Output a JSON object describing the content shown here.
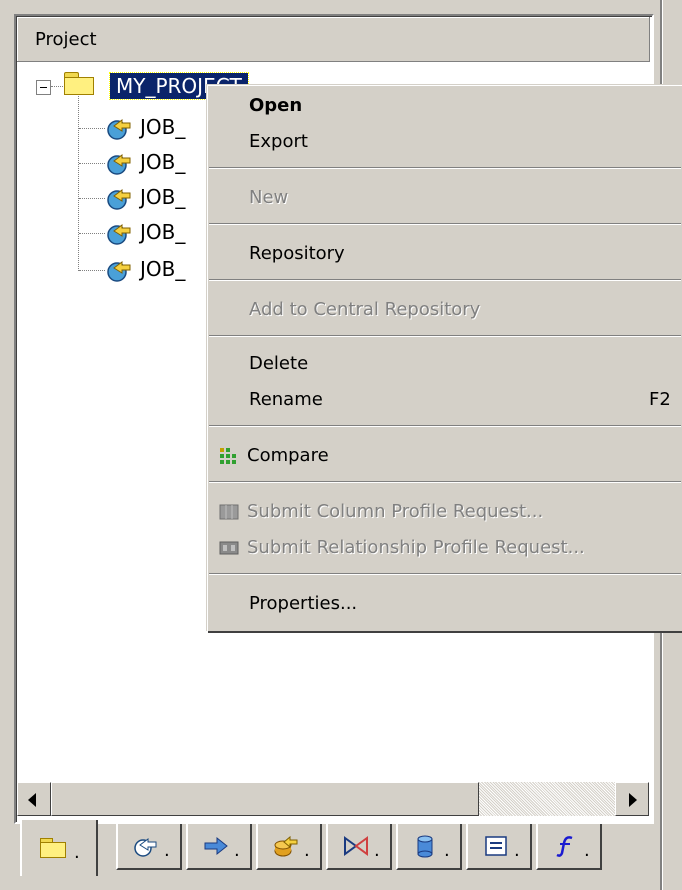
{
  "panel": {
    "header_label": "Project"
  },
  "tree": {
    "project": {
      "label": "MY_PROJECT",
      "visible_label": "MY_PROJECT",
      "selected": true,
      "expanded": true
    },
    "jobs": [
      {
        "label": "JOB_"
      },
      {
        "label": "JOB_"
      },
      {
        "label": "JOB_"
      },
      {
        "label": "JOB_"
      },
      {
        "label": "JOB_"
      }
    ]
  },
  "context_menu": {
    "items": [
      {
        "label": "Open",
        "bold": true,
        "enabled": true
      },
      {
        "label": "Export",
        "enabled": true
      },
      {
        "label": "New",
        "enabled": false
      },
      {
        "label": "Repository",
        "enabled": true
      },
      {
        "label": "Add to Central Repository",
        "enabled": false
      },
      {
        "label": "Delete",
        "enabled": true
      },
      {
        "label": "Rename",
        "shortcut": "F2",
        "enabled": true
      },
      {
        "label": "Compare",
        "icon": "compare-icon",
        "enabled": true
      },
      {
        "label": "Submit Column Profile Request...",
        "icon": "column-profile-icon",
        "enabled": false
      },
      {
        "label": "Submit Relationship Profile Request...",
        "icon": "relationship-profile-icon",
        "enabled": false
      },
      {
        "label": "Properties...",
        "enabled": true
      }
    ]
  },
  "bottom_tabs": [
    {
      "icon": "folder-icon",
      "label": ".",
      "active": true
    },
    {
      "icon": "job-icon",
      "label": "."
    },
    {
      "icon": "workflow-icon",
      "label": "."
    },
    {
      "icon": "dataflow-icon",
      "label": "."
    },
    {
      "icon": "transform-icon",
      "label": "."
    },
    {
      "icon": "datastore-icon",
      "label": "."
    },
    {
      "icon": "format-icon",
      "label": "."
    },
    {
      "icon": "function-icon",
      "label": "."
    }
  ],
  "colors": {
    "selection": "#0a246a",
    "face": "#d4d0c8"
  }
}
